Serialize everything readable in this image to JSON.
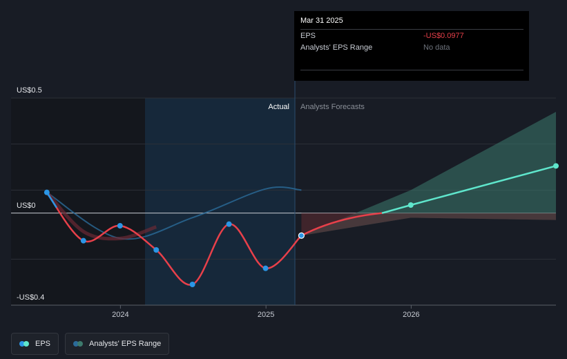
{
  "chart_data": {
    "type": "line",
    "y_unit_labels": {
      "top": "US$0.5",
      "zero": "US$0",
      "bottom": "-US$0.4"
    },
    "ylim": [
      -0.4,
      0.5
    ],
    "x_ticks": [
      "2024",
      "2025",
      "2026"
    ],
    "region_labels": {
      "actual": "Actual",
      "forecast": "Analysts Forecasts"
    },
    "series": [
      {
        "name": "EPS",
        "color_past": "#2b96e6",
        "color_negative": "#e8404a",
        "color_forecast": "#5fe6cc",
        "points": [
          {
            "x": "2023-06-30",
            "y": 0.09
          },
          {
            "x": "2023-09-30",
            "y": -0.12
          },
          {
            "x": "2023-12-31",
            "y": -0.055
          },
          {
            "x": "2024-03-31",
            "y": -0.16
          },
          {
            "x": "2024-06-30",
            "y": -0.31
          },
          {
            "x": "2024-09-30",
            "y": -0.048
          },
          {
            "x": "2024-12-31",
            "y": -0.24
          },
          {
            "x": "2025-03-31",
            "y": -0.0977
          }
        ],
        "forecast_points": [
          {
            "x": "2025-03-31",
            "y": -0.0977
          },
          {
            "x": "2025-12-31",
            "y": 0.035
          },
          {
            "x": "2026-12-31",
            "y": 0.205
          }
        ]
      }
    ],
    "range_band": {
      "name": "Analysts' EPS Range",
      "points": [
        {
          "x": "2025-03-31",
          "low": -0.0977,
          "high": -0.0977
        },
        {
          "x": "2025-12-31",
          "low": -0.02,
          "high": 0.1
        },
        {
          "x": "2026-12-31",
          "low": -0.03,
          "high": 0.44
        }
      ],
      "color": "#3d7a6d"
    },
    "revenue_trend_line": [
      {
        "x": "2023-06-30",
        "y": 0.09
      },
      {
        "x": "2023-12-31",
        "y": -0.11
      },
      {
        "x": "2024-06-30",
        "y": -0.02
      },
      {
        "x": "2024-12-31",
        "y": 0.105
      },
      {
        "x": "2025-03-31",
        "y": 0.1
      }
    ],
    "grid": true,
    "legend": "bottom-left"
  },
  "tooltip": {
    "date": "Mar 31 2025",
    "eps_label": "EPS",
    "eps_value": "-US$0.0977",
    "range_label": "Analysts' EPS Range",
    "range_value": "No data"
  },
  "legend": {
    "eps_label": "EPS",
    "range_label": "Analysts' EPS Range",
    "eps_color_a": "#2b96e6",
    "eps_color_b": "#5fe6cc",
    "range_color_a": "#2b6b9a",
    "range_color_b": "#3d7a6d"
  }
}
